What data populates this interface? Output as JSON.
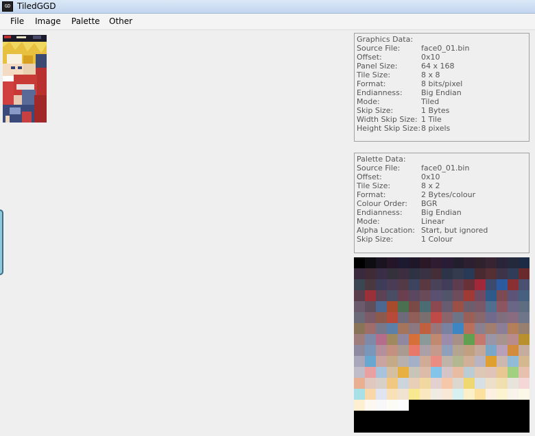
{
  "window": {
    "title": "TiledGGD",
    "icon": "app-icon"
  },
  "menu": {
    "items": [
      "File",
      "Image",
      "Palette",
      "Other"
    ]
  },
  "graphics_data": {
    "heading": "Graphics Data:",
    "rows": [
      {
        "label": "Source File:",
        "value": "face0_01.bin"
      },
      {
        "label": "Offset:",
        "value": "0x10"
      },
      {
        "label": "Panel Size:",
        "value": "64 x 168"
      },
      {
        "label": "Tile Size:",
        "value": "8 x 8"
      },
      {
        "label": "Format:",
        "value": "8 bits/pixel"
      },
      {
        "label": "Endianness:",
        "value": "Big Endian"
      },
      {
        "label": "Mode:",
        "value": "Tiled"
      },
      {
        "label": "Skip Size:",
        "value": "1 Bytes"
      },
      {
        "label": "Width Skip Size:",
        "value": "1 Tile"
      },
      {
        "label": "Height Skip Size:",
        "value": "8 pixels"
      }
    ]
  },
  "palette_data": {
    "heading": "Palette Data:",
    "rows": [
      {
        "label": "Source File:",
        "value": "face0_01.bin"
      },
      {
        "label": "Offset:",
        "value": "0x10"
      },
      {
        "label": "Tile Size:",
        "value": "8 x 2"
      },
      {
        "label": "Format:",
        "value": "2 Bytes/colour"
      },
      {
        "label": "Colour Order:",
        "value": "BGR"
      },
      {
        "label": "Endianness:",
        "value": "Big Endian"
      },
      {
        "label": "Mode:",
        "value": "Linear"
      },
      {
        "label": "Alpha Location:",
        "value": "Start, but ignored"
      },
      {
        "label": "Skip Size:",
        "value": "1 Colour"
      }
    ]
  },
  "palette_swatches": [
    [
      "#000000",
      "#0e0e12",
      "#1a1420",
      "#241628",
      "#1c1a30",
      "#20162a",
      "#2a1826",
      "#301c30",
      "#281c36",
      "#221e2e",
      "#2c2030",
      "#30222c",
      "#362432",
      "#2a2438",
      "#242a3c",
      "#1c2a44"
    ],
    [
      "#3a2a3e",
      "#402a36",
      "#3a2e46",
      "#34303c",
      "#3c2e40",
      "#2e3242",
      "#383244",
      "#442e38",
      "#2c3448",
      "#343a50",
      "#283a56",
      "#482a30",
      "#543034",
      "#3e3448",
      "#303c58",
      "#6a2a2c"
    ],
    [
      "#3a4652",
      "#4a3840",
      "#3e3c58",
      "#4a3c54",
      "#523a46",
      "#3c4460",
      "#5a3840",
      "#4a4258",
      "#423e5a",
      "#5c3c4e",
      "#6a3038",
      "#a02838",
      "#3c4a6e",
      "#2c5aa0",
      "#8a3032",
      "#4a5070"
    ],
    [
      "#5a3e4c",
      "#9a3038",
      "#5c4254",
      "#4a4e64",
      "#6a4050",
      "#5a4860",
      "#684a58",
      "#5a5070",
      "#52546c",
      "#6e4c5c",
      "#a03a34",
      "#704a60",
      "#2e5a8a",
      "#7c4a52",
      "#5c5478",
      "#486080"
    ],
    [
      "#6a5a6c",
      "#604e5c",
      "#4a6890",
      "#a84a2c",
      "#4a7050",
      "#7a4a48",
      "#4a6c72",
      "#8a4a50",
      "#6a5c70",
      "#9a5044",
      "#6c5e6c",
      "#7a5868",
      "#506e90",
      "#8c5660",
      "#6a6686",
      "#5e6e80"
    ],
    [
      "#6a6a78",
      "#7c5a68",
      "#8c5a4c",
      "#b84a3a",
      "#6e6a7c",
      "#906058",
      "#7a6e6e",
      "#c04a48",
      "#8c646c",
      "#6c7486",
      "#9a6058",
      "#88686c",
      "#706a8c",
      "#7e6e7e",
      "#8a6c80",
      "#70768a"
    ],
    [
      "#8a7458",
      "#a06e6a",
      "#78788c",
      "#5c80a8",
      "#a4745c",
      "#8c7880",
      "#c0603e",
      "#98767a",
      "#7a82a2",
      "#3c86c4",
      "#b8705c",
      "#8a8090",
      "#a27e6e",
      "#8c7e96",
      "#b4805a",
      "#988070"
    ],
    [
      "#9e7e7c",
      "#7e8aa8",
      "#b46e8c",
      "#a08860",
      "#9088a0",
      "#d47038",
      "#8a9a98",
      "#c08a70",
      "#9a8caa",
      "#a69088",
      "#60a050",
      "#c4786e",
      "#9a96a8",
      "#a8948e",
      "#b88c8c",
      "#b8902e"
    ],
    [
      "#8e8aa0",
      "#7a96b8",
      "#b4909c",
      "#c49080",
      "#a89c92",
      "#e87868",
      "#aca0a8",
      "#c69a8a",
      "#90a0bc",
      "#b4a490",
      "#c0a080",
      "#c4a89a",
      "#7aa6c8",
      "#b8a0b8",
      "#d28c3c",
      "#c4ac9e"
    ],
    [
      "#a8a8ba",
      "#68a8d0",
      "#caa4a0",
      "#c4aa86",
      "#b8b0ae",
      "#a4b0c8",
      "#d0ac98",
      "#e88c84",
      "#c0b4aa",
      "#b4b890",
      "#d0b098",
      "#b8b4c4",
      "#e0a030",
      "#ccb8ae",
      "#90bcd8",
      "#d4b890"
    ],
    [
      "#c0bcc8",
      "#e8a0a0",
      "#a8c4dc",
      "#d4c0a0",
      "#e8b040",
      "#c8c4b8",
      "#dcbca8",
      "#84c4e8",
      "#d4c4c8",
      "#e8bca0",
      "#bcccd4",
      "#dcc8b4",
      "#e0c4b8",
      "#e8c890",
      "#a0d080",
      "#e8c0b0"
    ],
    [
      "#e8b090",
      "#e0c8c0",
      "#d8d0c8",
      "#f0c880",
      "#ccd4dc",
      "#e8d0b8",
      "#f0d8a0",
      "#e4d0d0",
      "#f4c8a8",
      "#dcd8d0",
      "#f0d870",
      "#d8e0e4",
      "#ece0c8",
      "#f0e0b0",
      "#e8e4dc",
      "#f4d8d8"
    ],
    [
      "#a8e0e8",
      "#f8d8a8",
      "#e0e4f0",
      "#f8e0b8",
      "#f0e4d0",
      "#f8e890",
      "#fce8c0",
      "#f0ece4",
      "#f8e8d8",
      "#d8f0f0",
      "#fcf0c8",
      "#fce0a0",
      "#fcf0e0",
      "#fcf4d0",
      "#f8f4ec",
      "#fcf8e8"
    ],
    [
      "#fcf0d0",
      "#fcf8f0",
      "#f8f8f8",
      "#fcfcf4",
      "#fcfcfc",
      "#000000",
      "#000000",
      "#000000",
      "#000000",
      "#000000",
      "#000000",
      "#000000",
      "#000000",
      "#000000",
      "#000000",
      "#000000"
    ]
  ]
}
